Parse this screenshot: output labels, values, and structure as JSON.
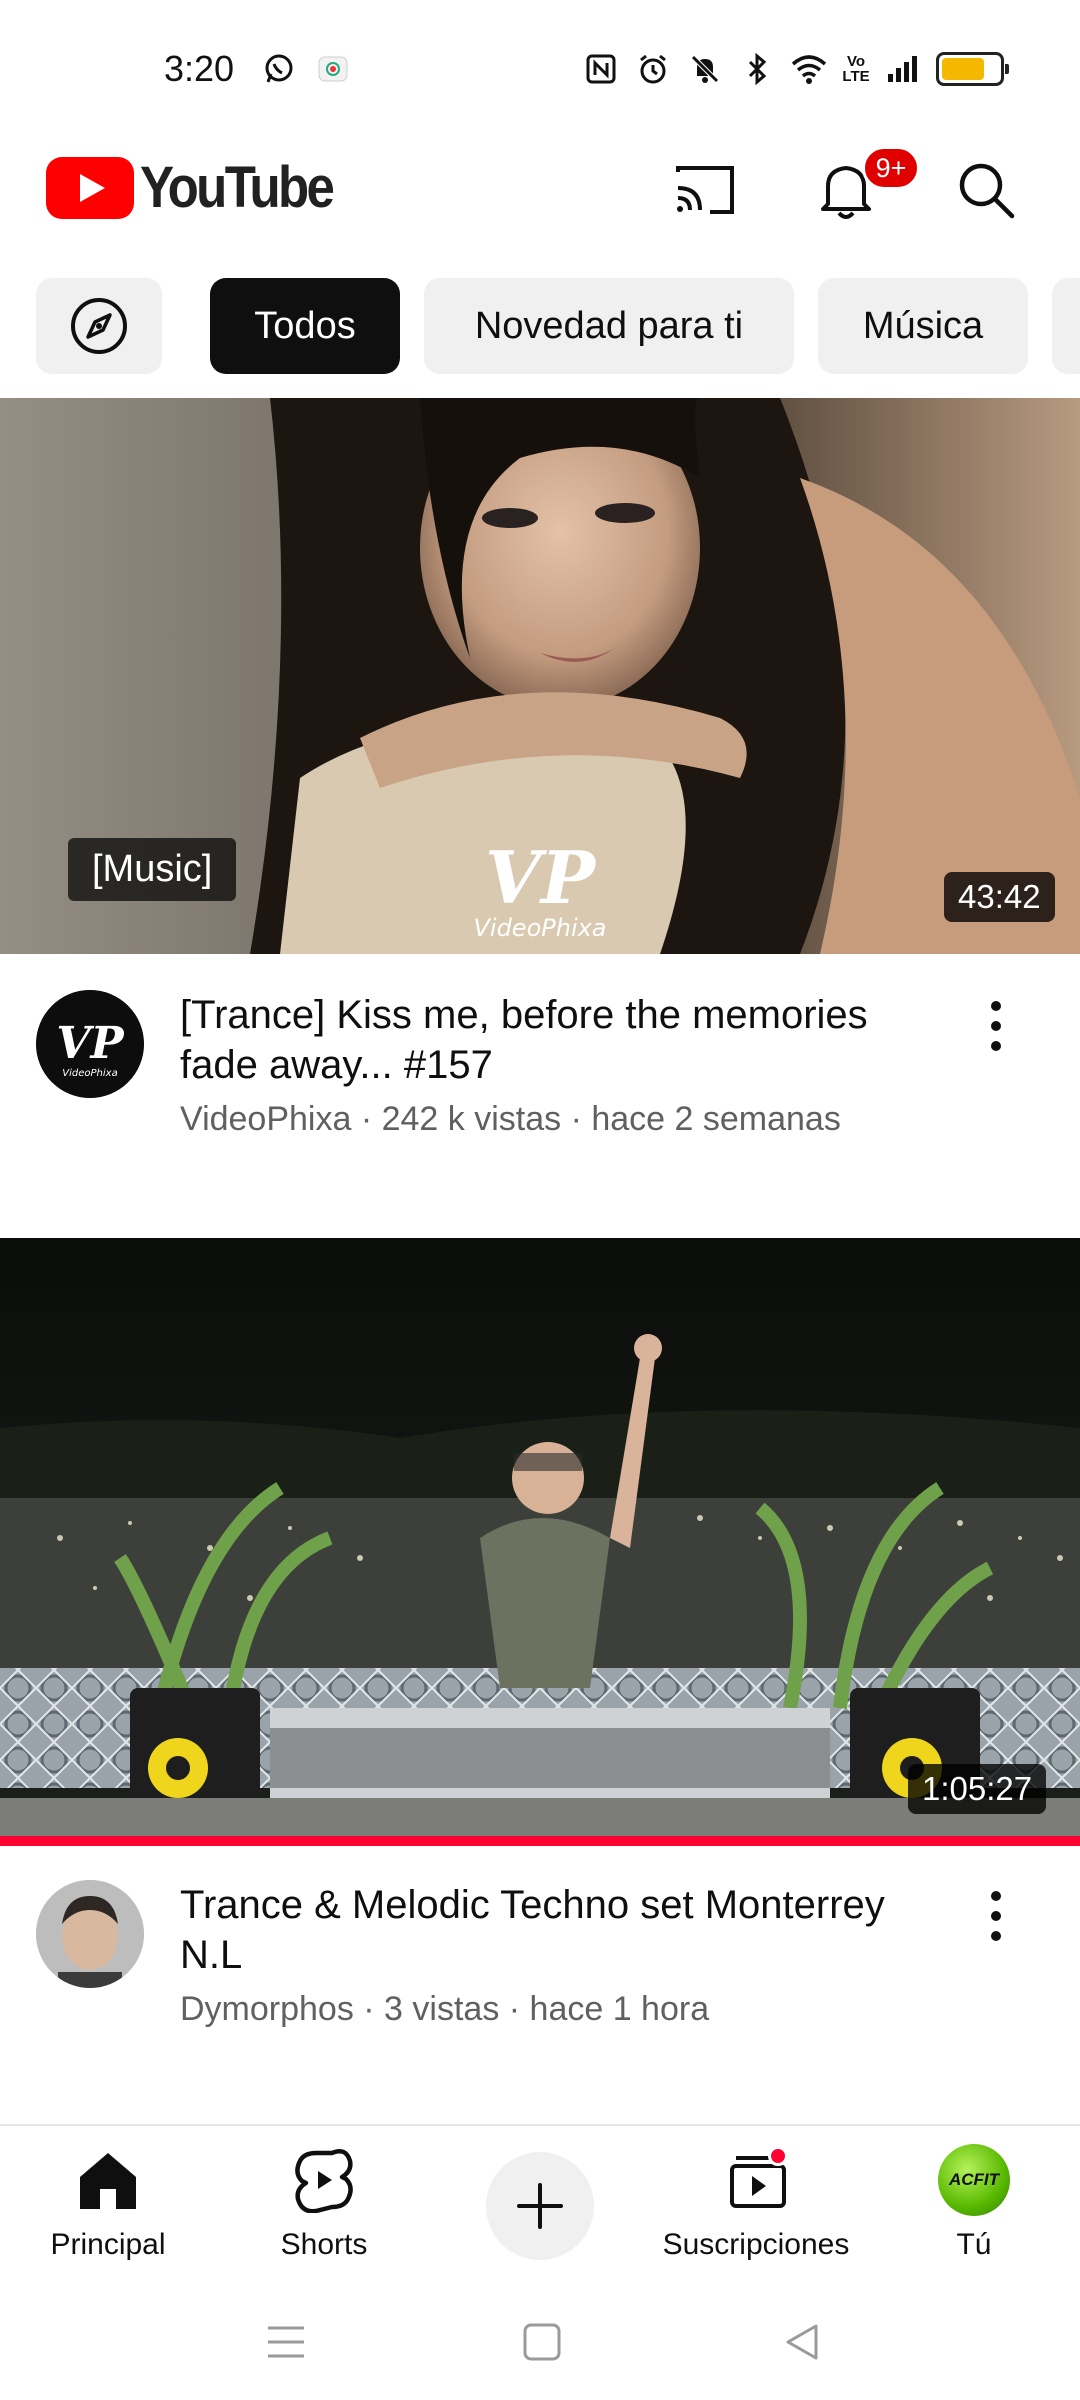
{
  "status_bar": {
    "time": "3:20",
    "left_icons": [
      "whatsapp-icon",
      "screen-record-icon"
    ],
    "right_icons": [
      "nfc-icon",
      "alarm-icon",
      "mute-icon",
      "bluetooth-icon",
      "wifi-icon",
      "volte-icon",
      "signal-icon",
      "battery-icon"
    ],
    "volte_text": "Vo\nLTE",
    "battery_level": 0.75
  },
  "header": {
    "logo_text": "YouTube",
    "notification_badge": "9+",
    "brand_color": "#ff0000"
  },
  "chips": {
    "items": [
      {
        "label": "",
        "icon": "explore-icon",
        "active": false
      },
      {
        "label": "Todos",
        "active": true
      },
      {
        "label": "Novedad para ti",
        "active": false
      },
      {
        "label": "Música",
        "active": false
      }
    ]
  },
  "videos": [
    {
      "title": "[Trance] Kiss me, before the memories fade away... #157",
      "meta": "VideoPhixa · 242 k vistas · hace 2 semanas",
      "duration": "43:42",
      "tag": "[Music]",
      "watermark": "VideoPhixa",
      "avatar_text": "VP"
    },
    {
      "title": "Trance & Melodic Techno set Monterrey N.L",
      "meta": "Dymorphos · 3 vistas · hace 1 hora",
      "duration": "1:05:27",
      "watched_progress": 1.0
    }
  ],
  "bottom_nav": {
    "home": "Principal",
    "shorts": "Shorts",
    "subscriptions": "Suscripciones",
    "you": "Tú",
    "you_avatar_text": "ACFIT"
  }
}
